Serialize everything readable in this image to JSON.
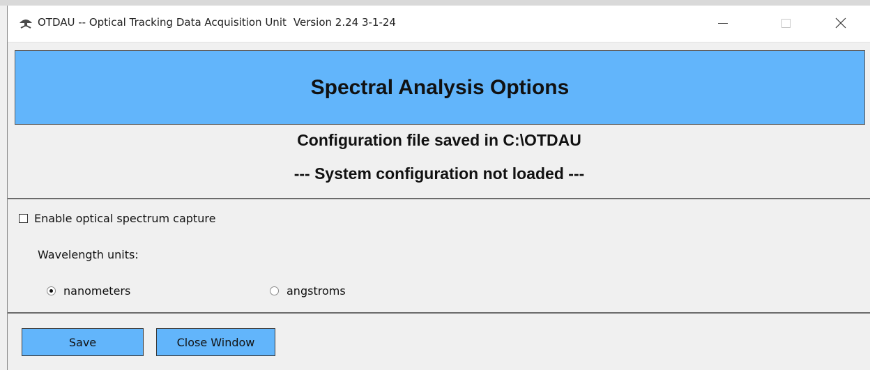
{
  "window": {
    "app_title": "OTDAU -- Optical Tracking Data Acquisition Unit",
    "version": "Version 2.24 3-1-24",
    "icon": "satellite-dish-icon",
    "controls": {
      "minimize": "minimize-icon",
      "maximize": "maximize-icon",
      "close": "close-icon"
    }
  },
  "header": {
    "title": "Spectral Analysis Options",
    "color": "#62b5fb"
  },
  "status": {
    "config_saved": "Configuration file saved in C:\\OTDAU",
    "config_loaded": "--- System configuration not loaded ---"
  },
  "options": {
    "enable_capture": {
      "label": "Enable optical spectrum capture",
      "checked": false
    },
    "wavelength_units": {
      "label": "Wavelength units:",
      "options": [
        {
          "label": "nanometers",
          "selected": true
        },
        {
          "label": "angstroms",
          "selected": false
        }
      ]
    }
  },
  "buttons": {
    "save": "Save",
    "close_window": "Close Window",
    "color": "#62b5fb"
  }
}
